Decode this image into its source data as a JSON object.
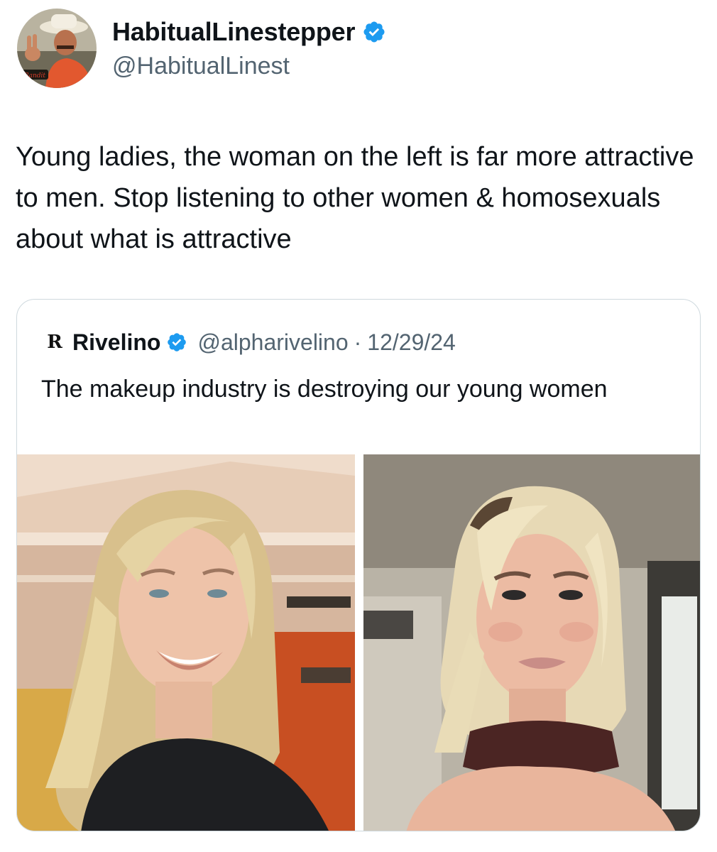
{
  "tweet": {
    "author": {
      "display_name": "HabitualLinestepper",
      "handle": "@HabitualLinest",
      "verified": true,
      "avatar_icon": "profile-photo-icon"
    },
    "text": "Young ladies, the woman on the left is far more attractive to men. Stop listening to other women & homosexuals about what is attractive"
  },
  "quoted_tweet": {
    "logo_glyph": "R",
    "display_name": "Rivelino",
    "handle": "@alpharivelino",
    "separator": "·",
    "date": "12/29/24",
    "verified": true,
    "text": "The makeup industry is destroying our young women",
    "media": [
      {
        "alt_icon": "photo-left-no-makeup"
      },
      {
        "alt_icon": "photo-right-with-makeup"
      }
    ]
  },
  "colors": {
    "verified_blue": "#1d9bf0",
    "secondary_text": "#536471",
    "border": "#cfd9de"
  }
}
